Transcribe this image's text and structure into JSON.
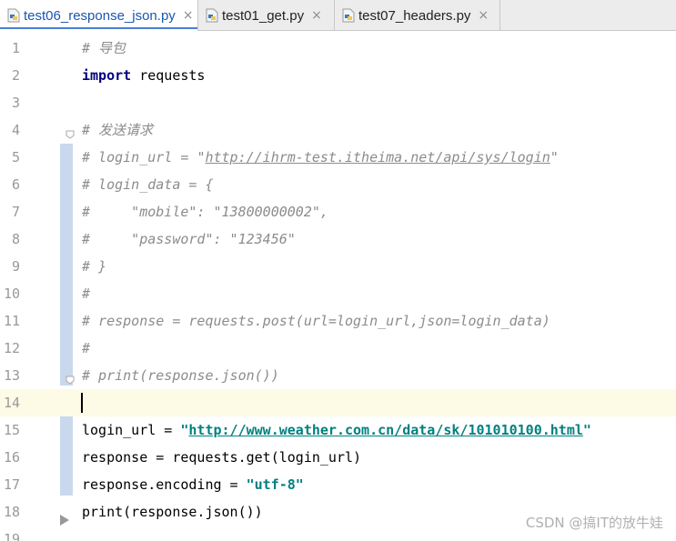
{
  "tabs": [
    {
      "label": "test06_response_json.py",
      "active": true
    },
    {
      "label": "test01_get.py",
      "active": false
    },
    {
      "label": "test07_headers.py",
      "active": false
    }
  ],
  "close_glyph": "×",
  "icons": {
    "file": "python-file-icon",
    "close": "close-icon",
    "fold": "fold-icon"
  },
  "colors": {
    "comment": "#8c8c8c",
    "keyword": "#000080",
    "string": "#008080",
    "fold_bar": "#c9d8ec",
    "current_line": "#fdfbe6",
    "tab_accent": "#4a7fd4"
  },
  "editor": {
    "current_line": 14,
    "lines": [
      {
        "num": "1",
        "tokens": [
          {
            "t": "cm",
            "v": "# 导包"
          }
        ]
      },
      {
        "num": "2",
        "tokens": [
          {
            "t": "kw",
            "v": "import"
          },
          {
            "t": "tx",
            "v": " requests"
          }
        ]
      },
      {
        "num": "3",
        "tokens": []
      },
      {
        "num": "4",
        "tokens": [
          {
            "t": "cm",
            "v": "# 发送请求"
          }
        ]
      },
      {
        "num": "5",
        "tokens": [
          {
            "t": "cm",
            "v": "# login_url = "
          },
          {
            "t": "cm-str",
            "v": "\""
          },
          {
            "t": "cm-url",
            "v": "http://ihrm-test.itheima.net/api/sys/login"
          },
          {
            "t": "cm-str",
            "v": "\""
          }
        ]
      },
      {
        "num": "6",
        "tokens": [
          {
            "t": "cm",
            "v": "# login_data = {"
          }
        ]
      },
      {
        "num": "7",
        "tokens": [
          {
            "t": "cm",
            "v": "#     \"mobile\": \"13800000002\","
          }
        ]
      },
      {
        "num": "8",
        "tokens": [
          {
            "t": "cm",
            "v": "#     \"password\": \"123456\""
          }
        ]
      },
      {
        "num": "9",
        "tokens": [
          {
            "t": "cm",
            "v": "# }"
          }
        ]
      },
      {
        "num": "10",
        "tokens": [
          {
            "t": "cm",
            "v": "#"
          }
        ]
      },
      {
        "num": "11",
        "tokens": [
          {
            "t": "cm",
            "v": "# response = requests.post(url=login_url,json=login_data)"
          }
        ]
      },
      {
        "num": "12",
        "tokens": [
          {
            "t": "cm",
            "v": "#"
          }
        ]
      },
      {
        "num": "13",
        "tokens": [
          {
            "t": "cm",
            "v": "# print(response.json())"
          }
        ]
      },
      {
        "num": "14",
        "tokens": []
      },
      {
        "num": "15",
        "tokens": [
          {
            "t": "tx",
            "v": "login_url = "
          },
          {
            "t": "str",
            "v": "\""
          },
          {
            "t": "url",
            "v": "http://www.weather.com.cn/data/sk/101010100.html"
          },
          {
            "t": "str",
            "v": "\""
          }
        ]
      },
      {
        "num": "16",
        "tokens": [
          {
            "t": "tx",
            "v": "response = requests.get(login_url)"
          }
        ]
      },
      {
        "num": "17",
        "tokens": [
          {
            "t": "tx",
            "v": "response.encoding = "
          },
          {
            "t": "str",
            "v": "\"utf-8\""
          }
        ]
      },
      {
        "num": "18",
        "tokens": [
          {
            "t": "tx",
            "v": "print(response.json())"
          }
        ]
      },
      {
        "num": "19",
        "tokens": []
      }
    ]
  },
  "watermark": "CSDN @搞IT的放牛娃"
}
